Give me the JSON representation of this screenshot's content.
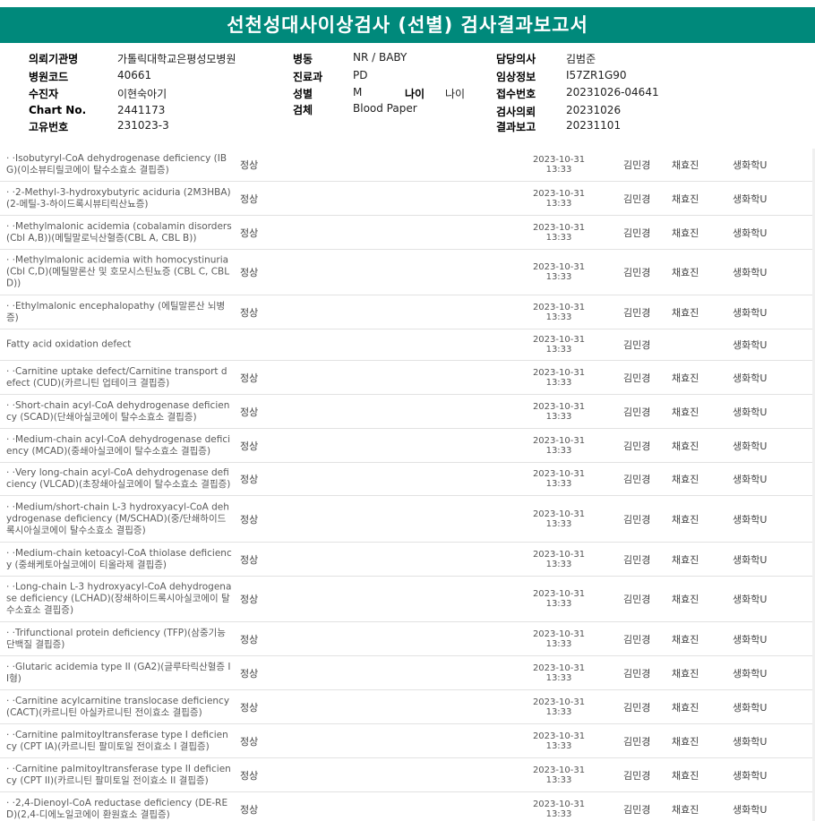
{
  "title": "선천성대사이상검사 (선별) 검사결과보고서",
  "header": {
    "col1": [
      {
        "label": "의뢰기관명",
        "value": "가톨릭대학교은평성모병원"
      },
      {
        "label": "병원코드",
        "value": "40661"
      },
      {
        "label": "수진자",
        "value": "이현숙아기"
      },
      {
        "label": "Chart No.",
        "value": "2441173"
      },
      {
        "label": "고유번호",
        "value": "231023-3"
      }
    ],
    "col2": [
      {
        "label": "병동",
        "value": "NR / BABY"
      },
      {
        "label": "진료과",
        "value": "PD"
      },
      {
        "label": "성별",
        "value": "M"
      },
      {
        "label": "검체",
        "value": "Blood Paper"
      }
    ],
    "age": {
      "label": "나이",
      "value": "나이"
    },
    "col3": [
      {
        "label": "담당의사",
        "value": "김범준"
      },
      {
        "label": "임상정보",
        "value": "I57ZR1G90"
      },
      {
        "label": "접수번호",
        "value": "20231026-04641"
      },
      {
        "label": "검사의뢰",
        "value": "20231026"
      },
      {
        "label": "결과보고",
        "value": "20231101"
      }
    ]
  },
  "rows": [
    {
      "name": "  · ·Isobutyryl-CoA dehydrogenase deficiency (IBG)(이소뷰티릴코에이 탈수소효소 결핍증)",
      "result": "정상",
      "date": "2023-10-31",
      "time": "13:33",
      "p1": "김민경",
      "p2": "채효진",
      "dept": "생화학U"
    },
    {
      "name": "  · ·2-Methyl-3-hydroxybutyric aciduria (2M3HBA)(2-메틸-3-하이드록시뷰티릭산뇨증)",
      "result": "정상",
      "date": "2023-10-31",
      "time": "13:33",
      "p1": "김민경",
      "p2": "채효진",
      "dept": "생화학U"
    },
    {
      "name": "  · ·Methylmalonic acidemia (cobalamin disorders (Cbl A,B))(메틸말로닉산혈증(CBL A, CBL B))",
      "result": "정상",
      "date": "2023-10-31",
      "time": "13:33",
      "p1": "김민경",
      "p2": "채효진",
      "dept": "생화학U"
    },
    {
      "name": "  · ·Methylmalonic acidemia with homocystinuria (Cbl C,D)(메틸말론산 및 호모시스틴뇨증 (CBL C, CBL D))",
      "result": "정상",
      "date": "2023-10-31",
      "time": "13:33",
      "p1": "김민경",
      "p2": "채효진",
      "dept": "생화학U"
    },
    {
      "name": "  · ·Ethylmalonic encephalopathy (에틸말론산 뇌병증)",
      "result": "정상",
      "date": "2023-10-31",
      "time": "13:33",
      "p1": "김민경",
      "p2": "채효진",
      "dept": "생화학U"
    },
    {
      "name": "  Fatty acid oxidation defect",
      "result": "",
      "date": "2023-10-31",
      "time": "13:33",
      "p1": "김민경",
      "p2": "",
      "dept": "생화학U"
    },
    {
      "name": "  · ·Carnitine uptake defect/Carnitine transport defect (CUD)(카르니틴 업테이크 결핍증)",
      "result": "정상",
      "date": "2023-10-31",
      "time": "13:33",
      "p1": "김민경",
      "p2": "채효진",
      "dept": "생화학U"
    },
    {
      "name": "  · ·Short-chain acyl-CoA dehydrogenase deficiency (SCAD)(단쇄아실코에이 탈수소효소 결핍증)",
      "result": "정상",
      "date": "2023-10-31",
      "time": "13:33",
      "p1": "김민경",
      "p2": "채효진",
      "dept": "생화학U"
    },
    {
      "name": "  · ·Medium-chain acyl-CoA dehydrogenase deficiency (MCAD)(중쇄아실코에이 탈수소효소 결핍증)",
      "result": "정상",
      "date": "2023-10-31",
      "time": "13:33",
      "p1": "김민경",
      "p2": "채효진",
      "dept": "생화학U"
    },
    {
      "name": "  · ·Very long-chain acyl-CoA dehydrogenase deficiency (VLCAD)(초장쇄아실코에이 탈수소효소 결핍증)",
      "result": "정상",
      "date": "2023-10-31",
      "time": "13:33",
      "p1": "김민경",
      "p2": "채효진",
      "dept": "생화학U"
    },
    {
      "name": "  · ·Medium/short-chain L-3 hydroxyacyl-CoA dehydrogenase deficiency (M/SCHAD)(중/단쇄하이드록시아실코에이 탈수소효소 결핍증)",
      "result": "정상",
      "date": "2023-10-31",
      "time": "13:33",
      "p1": "김민경",
      "p2": "채효진",
      "dept": "생화학U"
    },
    {
      "name": "  · ·Medium-chain ketoacyl-CoA thiolase deficiency (중쇄케토아실코에이 티올라제 결핍증)",
      "result": "정상",
      "date": "2023-10-31",
      "time": "13:33",
      "p1": "김민경",
      "p2": "채효진",
      "dept": "생화학U"
    },
    {
      "name": "  · ·Long-chain L-3 hydroxyacyl-CoA dehydrogenase deficiency (LCHAD)(장쇄하이드록시아실코에이 탈수소효소 결핍증)",
      "result": "정상",
      "date": "2023-10-31",
      "time": "13:33",
      "p1": "김민경",
      "p2": "채효진",
      "dept": "생화학U"
    },
    {
      "name": "  · ·Trifunctional protein deficiency (TFP)(삼중기능 단백질 결핍증)",
      "result": "정상",
      "date": "2023-10-31",
      "time": "13:33",
      "p1": "김민경",
      "p2": "채효진",
      "dept": "생화학U"
    },
    {
      "name": "  · ·Glutaric acidemia type II (GA2)(글루타릭산혈증 II형)",
      "result": "정상",
      "date": "2023-10-31",
      "time": "13:33",
      "p1": "김민경",
      "p2": "채효진",
      "dept": "생화학U"
    },
    {
      "name": "  · ·Carnitine acylcarnitine translocase deficiency (CACT)(카르니틴 아실카르니틴 전이효소 결핍증)",
      "result": "정상",
      "date": "2023-10-31",
      "time": "13:33",
      "p1": "김민경",
      "p2": "채효진",
      "dept": "생화학U"
    },
    {
      "name": "  · ·Carnitine palmitoyltransferase type I deficiency (CPT IA)(카르니틴 팔미토일 전이효소 I 결핍증)",
      "result": "정상",
      "date": "2023-10-31",
      "time": "13:33",
      "p1": "김민경",
      "p2": "채효진",
      "dept": "생화학U"
    },
    {
      "name": "  · ·Carnitine palmitoyltransferase type II deficiency (CPT II)(카르니틴 팔미토일 전이효소 II 결핍증)",
      "result": "정상",
      "date": "2023-10-31",
      "time": "13:33",
      "p1": "김민경",
      "p2": "채효진",
      "dept": "생화학U"
    },
    {
      "name": "  · ·2,4-Dienoyl-CoA reductase deficiency (DE-RED)(2,4-디에노일코에이 환원효소 결핍증)",
      "result": "정상",
      "date": "2023-10-31",
      "time": "13:33",
      "p1": "김민경",
      "p2": "채효진",
      "dept": "생화학U"
    }
  ]
}
